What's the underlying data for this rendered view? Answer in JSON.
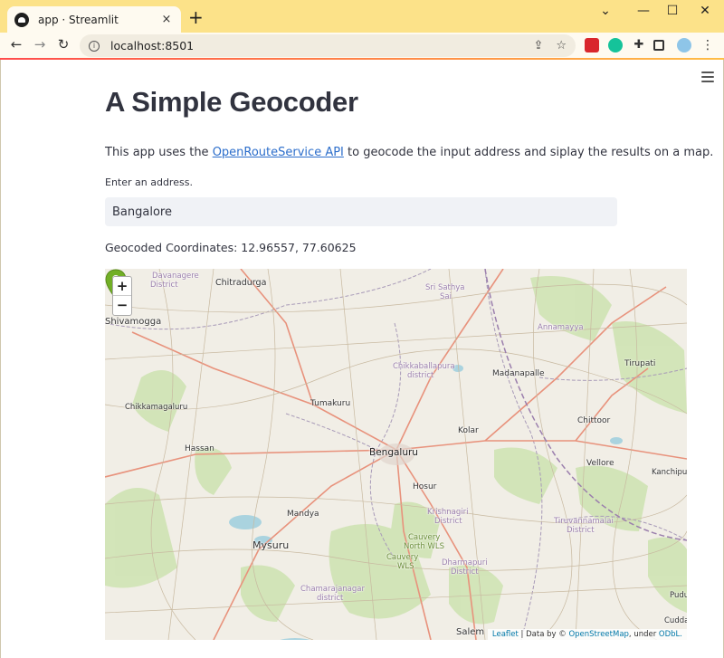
{
  "browser": {
    "tab_title": "app · Streamlit",
    "url": "localhost:8501",
    "new_tab_symbol": "+",
    "close_tab_symbol": "×"
  },
  "app": {
    "title": "A Simple Geocoder",
    "description_prefix": "This app uses the ",
    "description_link": "OpenRouteService API",
    "description_suffix": " to geocode the input address and siplay the results on a map.",
    "input_label": "Enter an address.",
    "input_value": "Bangalore",
    "coordinates_text": "Geocoded Coordinates: 12.96557, 77.60625"
  },
  "map": {
    "zoom_in": "+",
    "zoom_out": "−",
    "attribution": {
      "leaflet": "Leaflet",
      "data_by": " | Data by © ",
      "osm": "OpenStreetMap",
      "under": ", under ",
      "odbl": "ODbL."
    },
    "marker_color": "#72af26",
    "places": [
      {
        "name": "Davanagere"
      },
      {
        "name": "District"
      },
      {
        "name": "Chitradurga"
      },
      {
        "name": "Shivamogga"
      },
      {
        "name": "Sri Sathya"
      },
      {
        "name": "Sai"
      },
      {
        "name": "Annamayya"
      },
      {
        "name": "Chikkaballapura"
      },
      {
        "name": "district"
      },
      {
        "name": "Madanapalle"
      },
      {
        "name": "Tirupati"
      },
      {
        "name": "Chikkamagaluru"
      },
      {
        "name": "Tumakuru"
      },
      {
        "name": "Chittoor"
      },
      {
        "name": "Kolar"
      },
      {
        "name": "Hassan"
      },
      {
        "name": "Bengaluru"
      },
      {
        "name": "Vellore"
      },
      {
        "name": "Kanchipur"
      },
      {
        "name": "Hosur"
      },
      {
        "name": "Mandya"
      },
      {
        "name": "Krishnagiri"
      },
      {
        "name": "District"
      },
      {
        "name": "Tiruvannamalai"
      },
      {
        "name": "District"
      },
      {
        "name": "Cauvery"
      },
      {
        "name": "North WLS"
      },
      {
        "name": "Mysuru"
      },
      {
        "name": "Cauvery"
      },
      {
        "name": "WLS"
      },
      {
        "name": "Dharmapuri"
      },
      {
        "name": "District"
      },
      {
        "name": "Chamarajanagar"
      },
      {
        "name": "district"
      },
      {
        "name": "Pudu"
      },
      {
        "name": "Cudda"
      },
      {
        "name": "Salem"
      }
    ]
  }
}
